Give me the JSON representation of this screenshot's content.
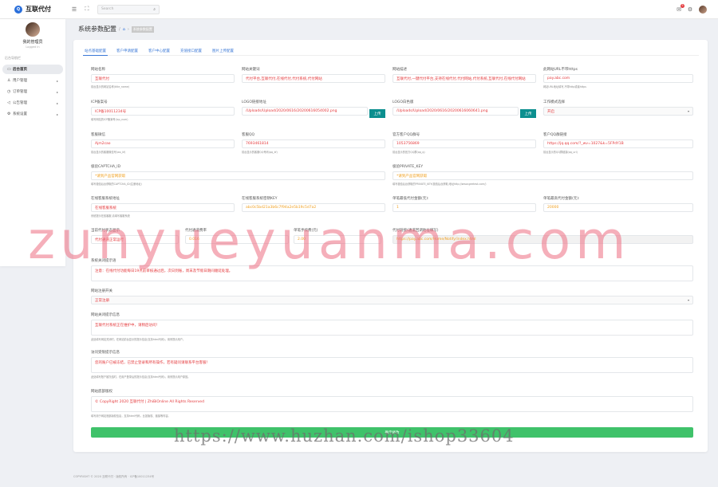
{
  "brand": {
    "logo_letter": "Q",
    "name": "互联代付"
  },
  "topbar": {
    "search_placeholder": "Search",
    "notification_count": "5"
  },
  "user": {
    "name": "我的管理员",
    "role": "Logged in"
  },
  "nav": {
    "title": "后台导航栏",
    "items": [
      {
        "label": "后台首页",
        "icon": "monitor-icon",
        "active": true
      },
      {
        "label": "用户管理",
        "icon": "user-icon"
      },
      {
        "label": "订单管理",
        "icon": "clock-icon"
      },
      {
        "label": "公告管理",
        "icon": "megaphone-icon"
      },
      {
        "label": "系统设置",
        "icon": "settings-icon"
      }
    ]
  },
  "breadcrumb": {
    "title": "系统参数配置",
    "sep": "/",
    "current": "系统参数配置"
  },
  "tabs": [
    "站点基础配置",
    "客户申请配置",
    "客户中心配置",
    "充值接口配置",
    "图片上传配置"
  ],
  "fields": {
    "site_name": {
      "label": "网站名称",
      "value": "互联代付",
      "hint": "前台显示的网站名称(title_name)"
    },
    "keywords": {
      "label": "网站关键词",
      "value": "代付平台,互联代付,在线代付,代付系统,代付网站",
      "hint": ""
    },
    "description": {
      "label": "网站描述",
      "value": "互联代付,一键代付平台,支持在线代付,代付网站,代付系统,互联代付,在线代付网站",
      "hint": ""
    },
    "domain": {
      "label": "此网站URL不带https",
      "value": "pay.abc.com",
      "hint": "网站URL地址填写,不带http或者https"
    },
    "icp": {
      "label": "ICP备案号",
      "value": "ICP备10011234号",
      "hint": "填写网站的ICP备案号(icp_num)"
    },
    "logo": {
      "label": "LOGO链接地址",
      "value": "/Uploads/Upload/2020/0616/20200616054002.png",
      "button": "上传"
    },
    "logo_white": {
      "label": "LOGO白色版",
      "value": "/Uploads/Upload/2020/0616/20200616060641.png",
      "button": "上传"
    },
    "work_mode": {
      "label": "工作模式选择",
      "value": "开启"
    },
    "service_phone": {
      "label": "客服微信",
      "value": "Ajm2cao",
      "hint": "前台显示的客服微信号(wx_kf)"
    },
    "qq": {
      "label": "客服QQ",
      "value": "7693461814",
      "hint": "前台显示的客服QQ号码(qq_kf)"
    },
    "qq_group": {
      "label": "官方客户QQ群号",
      "value": "1053756869",
      "hint": "前台显示的官方QQ群(qq_q)"
    },
    "qq_group_link": {
      "label": "客户QQ群链接",
      "value": "https://jq.qq.com/?_wv=1027&k=5FPdY1B",
      "hint": "前台显示的QQ群链接(qq_url)"
    },
    "captcha_id": {
      "label": "极验CAPTCHA_ID",
      "value": "*请到产品官网获取",
      "hint": "填写极验后台获取的CAPTCHA_ID(注册地址)"
    },
    "private_key": {
      "label": "极验PRIVATE_KEY",
      "value": "*请到产品官网获取",
      "hint": "填写极验后台获取的PRIVATE_KEY(极验后台获取,地址http://www.geetest.com/)"
    },
    "notice_title": {
      "label": "在线客服系统地址",
      "value": "在线客服系统",
      "hint": "系统提示在线客服,请填写客服系统"
    },
    "notice_key": {
      "label": "在线客服系统密钥KEY",
      "value": "abc0c5bd21a3b6c7f94a2e5b19c5d7a2",
      "hint": ""
    },
    "min_amount": {
      "label": "单笔最低代付金额(元):",
      "value": "1"
    },
    "max_amount": {
      "label": "单笔最高代付金额(元):",
      "value": "20000"
    },
    "row6_a": {
      "label": "当前代付状态显示",
      "value": "代付通道正常运行"
    },
    "row6_b": {
      "label": "代付通道费率",
      "value": "0.016"
    },
    "row6_c": {
      "label": "单笔手续费(元)",
      "value": "2.00"
    },
    "row6_d": {
      "label": "代付链接(通道回调地址填写)",
      "value": "https://pay.abc.com/Home/Notify/index.html"
    },
    "close_reason": {
      "label": "系统关闭提示语",
      "value": "注意：在线代付功能每日19点前审核通过后，次日到账，周末及节假日期间顺延处理。"
    },
    "register_switch": {
      "label": "网站注册开关",
      "value": "正常注册"
    },
    "site_notice": {
      "label": "网站关闭提示信息",
      "value": "互联代付系统正在维护中，请稍后访问！",
      "hint": "此处填写网站关闭时，在网站前台显示的提示信息(支持html代码)，用来提示用户。"
    },
    "visitor_notice": {
      "label": "访问受限提示信息",
      "value": "您的账户已被冻结，已禁止登录和所有操作，若有疑问请联系平台客服！",
      "hint": "此处填写账户被冻结时，在用户登录后的提示信息(支持html代码)，用来提示用户原因。"
    },
    "copyright": {
      "label": "网站底部版权",
      "value": "© CopyRight 2020 互联代付 | ZhiBiOnline All Rights Reserved",
      "hint": "填写用于网站底部版权信息，支持html代码，比如版权、链接等内容。"
    }
  },
  "submit_label": "确定修改",
  "footer": "COPYRIGHT © 2020 互联代付 · 版权所有 · ICP备10011234号",
  "watermark_big": "zunyueyuanma.com",
  "watermark_small": "https://www.huzhan.com/ishop33604"
}
